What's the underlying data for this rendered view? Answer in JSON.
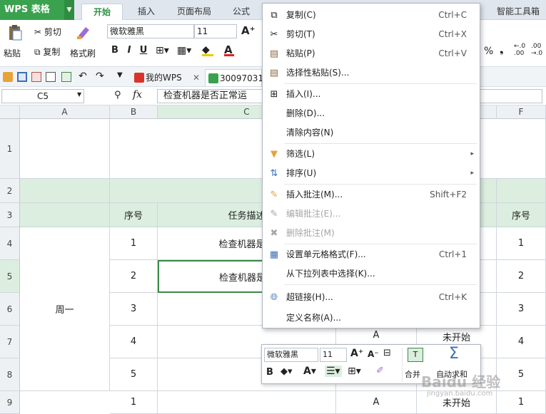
{
  "titlebar": {
    "app_name": "WPS 表格",
    "tabs": [
      "开始",
      "插入",
      "页面布局",
      "公式"
    ],
    "right_tab": "智能工具箱"
  },
  "ribbon": {
    "paste": "粘贴",
    "cut": "剪切",
    "copy": "复制",
    "format_painter": "格式刷",
    "font_name": "微软雅黑",
    "font_size": "11",
    "percent": "%"
  },
  "quickbar": {
    "doc_tab1": "我的WPS",
    "doc_tab2": "30097031"
  },
  "formula_bar": {
    "name_box": "C5",
    "fx": "fx",
    "content": "检查机器是否正常运"
  },
  "columns": [
    "A",
    "B",
    "C",
    "F"
  ],
  "rows": [
    "1",
    "2",
    "3",
    "4",
    "5",
    "6",
    "7",
    "8",
    "9"
  ],
  "sheet": {
    "seq_header": "序号",
    "task_header": "任务描述",
    "f_header": "序号",
    "day": "周一",
    "seq": [
      "1",
      "2",
      "3",
      "4",
      "5",
      "1"
    ],
    "tasks": [
      "检查机器是否",
      "检查机器是否"
    ],
    "d_col": [
      "A",
      "A"
    ],
    "e_col": [
      "未开始",
      "未开始"
    ],
    "f_col": [
      "1",
      "2",
      "3",
      "4",
      "5",
      "1"
    ]
  },
  "context_menu": {
    "items": [
      {
        "label": "复制(C)",
        "shortcut": "Ctrl+C",
        "icon": "copy-icon"
      },
      {
        "label": "剪切(T)",
        "shortcut": "Ctrl+X",
        "icon": "scissors-icon"
      },
      {
        "label": "粘贴(P)",
        "shortcut": "Ctrl+V",
        "icon": "paste-icon"
      },
      {
        "label": "选择性粘贴(S)...",
        "shortcut": "",
        "icon": "paste-special-icon"
      },
      {
        "label": "插入(I)...",
        "shortcut": "",
        "icon": "insert-icon"
      },
      {
        "label": "删除(D)...",
        "shortcut": "",
        "icon": ""
      },
      {
        "label": "清除内容(N)",
        "shortcut": "",
        "icon": ""
      },
      {
        "label": "筛选(L)",
        "shortcut": "",
        "icon": "filter-icon"
      },
      {
        "label": "排序(U)",
        "shortcut": "",
        "icon": "sort-icon"
      },
      {
        "label": "插入批注(M)...",
        "shortcut": "Shift+F2",
        "icon": "comment-icon"
      },
      {
        "label": "编辑批注(E)...",
        "shortcut": "",
        "icon": "edit-comment-icon"
      },
      {
        "label": "删除批注(M)",
        "shortcut": "",
        "icon": "delete-comment-icon"
      },
      {
        "label": "设置单元格格式(F)...",
        "shortcut": "Ctrl+1",
        "icon": "format-cells-icon"
      },
      {
        "label": "从下拉列表中选择(K)...",
        "shortcut": "",
        "icon": ""
      },
      {
        "label": "超链接(H)...",
        "shortcut": "Ctrl+K",
        "icon": "hyperlink-icon"
      },
      {
        "label": "定义名称(A)...",
        "shortcut": "",
        "icon": ""
      }
    ]
  },
  "mini_toolbar": {
    "font_name": "微软雅黑",
    "font_size": "11",
    "merge": "合并",
    "autosum": "自动求和"
  },
  "watermark": {
    "main": "Baidu 经验",
    "sub": "jingyan.baidu.com"
  }
}
